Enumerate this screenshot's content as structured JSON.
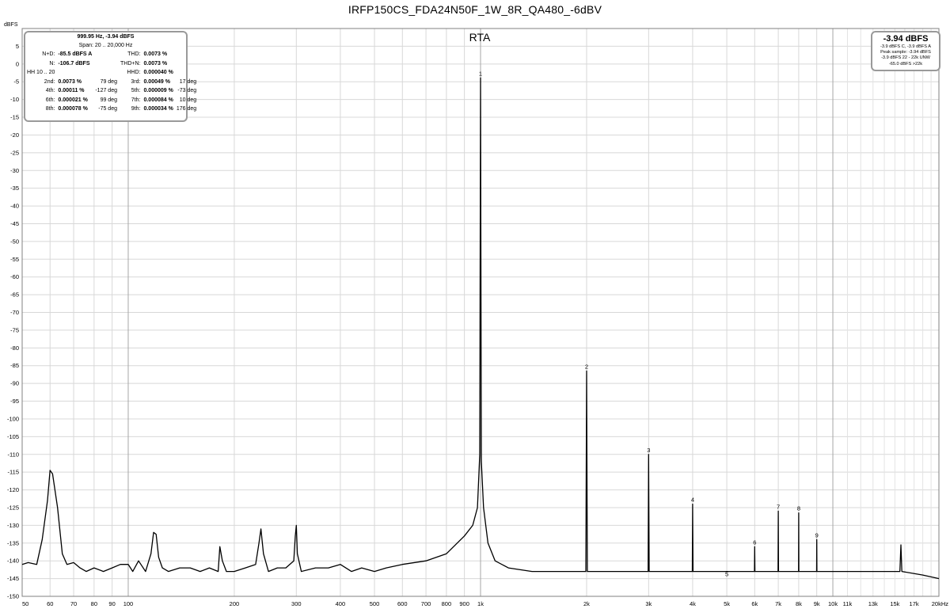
{
  "chart_data": {
    "type": "line",
    "title": "IRFP150CS_FDA24N50F_1W_8R_QA480_-6dBV",
    "subtitle": "RTA",
    "ylabel": "dBFS",
    "xlabel": "",
    "x_scale": "log",
    "xlim": [
      50,
      20000
    ],
    "ylim": [
      -150,
      10
    ],
    "grid": true,
    "x_tick_labels": [
      {
        "v": 50,
        "t": "50"
      },
      {
        "v": 60,
        "t": "60"
      },
      {
        "v": 70,
        "t": "70"
      },
      {
        "v": 80,
        "t": "80"
      },
      {
        "v": 90,
        "t": "90"
      },
      {
        "v": 100,
        "t": "100"
      },
      {
        "v": 200,
        "t": "200"
      },
      {
        "v": 300,
        "t": "300"
      },
      {
        "v": 400,
        "t": "400"
      },
      {
        "v": 500,
        "t": "500"
      },
      {
        "v": 600,
        "t": "600"
      },
      {
        "v": 700,
        "t": "700"
      },
      {
        "v": 800,
        "t": "800"
      },
      {
        "v": 900,
        "t": "900"
      },
      {
        "v": 1000,
        "t": "1k"
      },
      {
        "v": 2000,
        "t": "2k"
      },
      {
        "v": 3000,
        "t": "3k"
      },
      {
        "v": 4000,
        "t": "4k"
      },
      {
        "v": 5000,
        "t": "5k"
      },
      {
        "v": 6000,
        "t": "6k"
      },
      {
        "v": 7000,
        "t": "7k"
      },
      {
        "v": 8000,
        "t": "8k"
      },
      {
        "v": 9000,
        "t": "9k"
      },
      {
        "v": 10000,
        "t": "10k"
      },
      {
        "v": 11000,
        "t": "11k"
      },
      {
        "v": 13000,
        "t": "13k"
      },
      {
        "v": 15000,
        "t": "15k"
      },
      {
        "v": 17000,
        "t": "17k"
      },
      {
        "v": 20000,
        "t": "20kHz"
      }
    ],
    "y_tick_labels": [
      "5",
      "0",
      "-5",
      "-10",
      "-15",
      "-20",
      "-25",
      "-30",
      "-35",
      "-40",
      "-45",
      "-50",
      "-55",
      "-60",
      "-65",
      "-70",
      "-75",
      "-80",
      "-85",
      "-90",
      "-95",
      "-100",
      "-105",
      "-110",
      "-115",
      "-120",
      "-125",
      "-130",
      "-135",
      "-140",
      "-145",
      "-150"
    ],
    "series": [
      {
        "x": [
          50,
          52,
          55,
          57,
          59,
          60,
          61,
          63,
          65,
          67,
          70,
          73,
          76,
          80,
          85,
          90,
          95,
          100,
          103,
          107,
          112,
          116,
          118,
          120,
          122,
          125,
          130,
          140,
          150,
          160,
          170,
          180,
          182,
          185,
          190,
          200,
          215,
          230,
          235,
          238,
          242,
          250,
          265,
          280,
          295,
          298,
          300,
          302,
          310,
          340,
          370,
          400,
          430,
          460,
          500,
          540,
          600,
          700,
          800,
          900,
          950,
          980,
          995,
          1000,
          1005,
          1020,
          1050,
          1100,
          1200,
          1400,
          1600,
          1990,
          2000,
          2010,
          2400,
          2990,
          3000,
          3010,
          3500,
          3990,
          4000,
          4010,
          5000,
          5990,
          6000,
          6010,
          6990,
          7000,
          7010,
          7990,
          8000,
          8010,
          8990,
          9000,
          9010,
          12000,
          15500,
          15600,
          15700,
          18000,
          20000
        ],
        "values": [
          -141,
          -140.5,
          -141,
          -134,
          -123,
          -114.5,
          -115.5,
          -125,
          -138,
          -141,
          -140.5,
          -142,
          -143,
          -142,
          -143,
          -142,
          -141,
          -141,
          -143,
          -140,
          -143,
          -138,
          -132,
          -132.5,
          -139,
          -142,
          -143,
          -142,
          -142,
          -143,
          -142,
          -143,
          -136,
          -140,
          -143,
          -143,
          -142,
          -141,
          -135,
          -131,
          -138,
          -143,
          -142,
          -142,
          -140,
          -133,
          -130,
          -138,
          -143,
          -142,
          -142,
          -141,
          -143,
          -142,
          -143,
          -142,
          -141,
          -140,
          -138,
          -133,
          -130,
          -125,
          -110,
          -3.9,
          -112,
          -125,
          -135,
          -140,
          -142,
          -143,
          -143,
          -143,
          -86.5,
          -143,
          -143,
          -143,
          -110,
          -143,
          -143,
          -143,
          -124,
          -143,
          -143,
          -143,
          -136,
          -143,
          -143,
          -126,
          -143,
          -143,
          -126.5,
          -143,
          -143,
          -134,
          -143,
          -143,
          -143,
          -135.5,
          -143,
          -144,
          -145
        ]
      }
    ],
    "harmonic_labels": [
      {
        "n": "1",
        "x": 1000,
        "y": -3.9
      },
      {
        "n": "2",
        "x": 2000,
        "y": -86.5
      },
      {
        "n": "3",
        "x": 3000,
        "y": -110
      },
      {
        "n": "4",
        "x": 4000,
        "y": -124
      },
      {
        "n": "5",
        "x": 5000,
        "y": -145
      },
      {
        "n": "6",
        "x": 6000,
        "y": -136
      },
      {
        "n": "7",
        "x": 7000,
        "y": -126
      },
      {
        "n": "8",
        "x": 8000,
        "y": -126.5
      },
      {
        "n": "9",
        "x": 9000,
        "y": -134
      }
    ]
  },
  "stats_box": {
    "peak": "999.95 Hz, -3.94 dBFS",
    "span": "Span: 20 .. 20,000 Hz",
    "rows": [
      [
        "N+D:",
        "-85.5 dBFS A",
        "",
        "THD:",
        "0.0073 %",
        ""
      ],
      [
        "N:",
        "-106.7 dBFS",
        "",
        "THD+N:",
        "0.0073 %",
        ""
      ],
      [
        "HH 10 .. 20",
        "",
        "",
        "HHD:",
        "0.000040 %",
        ""
      ],
      [
        "2nd:",
        "0.0073 %",
        "79 deg",
        "3rd:",
        "0.00049 %",
        "17 deg"
      ],
      [
        "4th:",
        "0.00011 %",
        "-127 deg",
        "5th:",
        "0.000009 %",
        "-73 deg"
      ],
      [
        "6th:",
        "0.000021 %",
        "99 deg",
        "7th:",
        "0.000084 %",
        "10 deg"
      ],
      [
        "8th:",
        "0.000078 %",
        "-75 deg",
        "9th:",
        "0.000034 %",
        "176 deg"
      ]
    ]
  },
  "level_box": {
    "big": "-3.94 dBFS",
    "lines": [
      "-3.9 dBFS C, -3.9 dBFS A",
      "Peak sample: -3.94 dBFS",
      "-3.9 dBFS 22 - 22k UNW",
      "-65.0 dBFS >22k"
    ]
  }
}
